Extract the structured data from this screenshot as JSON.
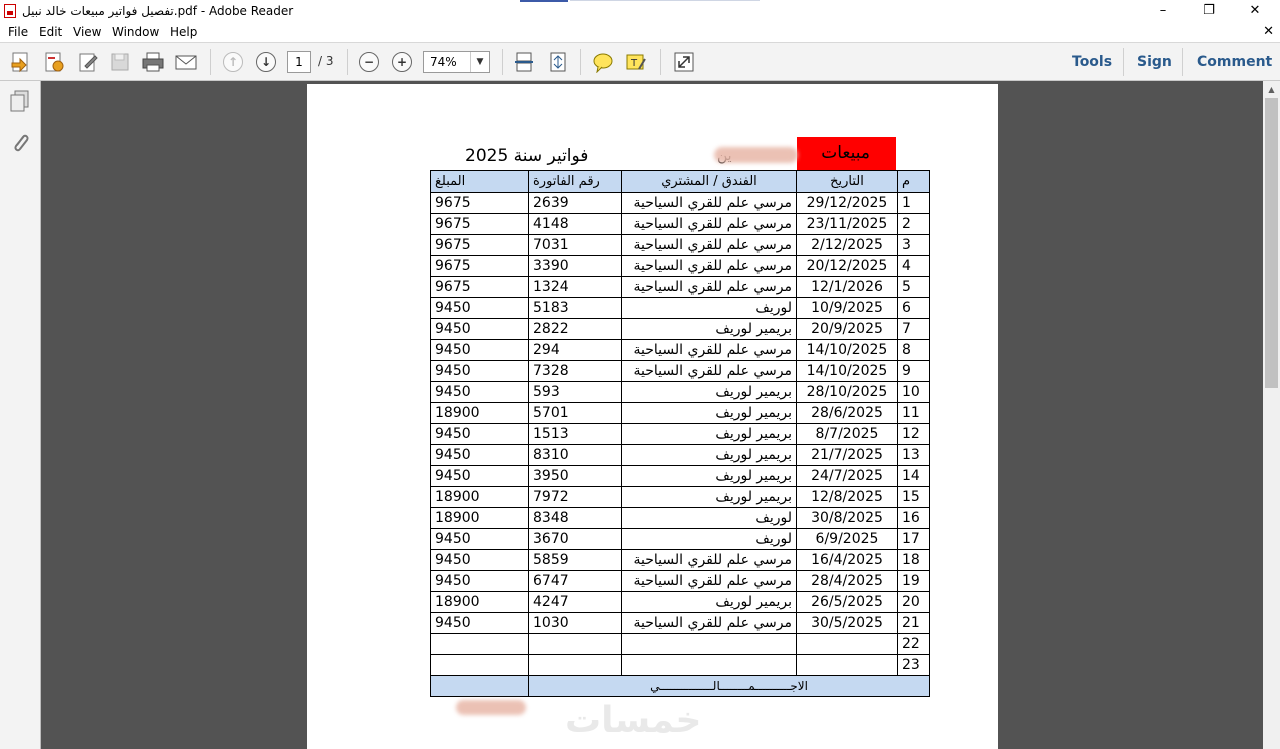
{
  "window": {
    "title": "تفصيل فواتير  مبيعات خالد نبيل.pdf - Adobe Reader",
    "controls": [
      "–",
      "❐",
      "✕"
    ]
  },
  "menu": {
    "items": [
      "File",
      "Edit",
      "View",
      "Window",
      "Help"
    ],
    "close": "✕"
  },
  "toolbar": {
    "page_current": "1",
    "page_total": "/ 3",
    "zoom": "74%",
    "tools_label": "Tools",
    "sign_label": "Sign",
    "comment_label": "Comment"
  },
  "document": {
    "sheet_label": "مبيعات",
    "sheet_title": "فواتير سنة 2025",
    "partial_text": "ين",
    "headers": {
      "num": "م",
      "date": "التاريخ",
      "hotel": "الفندق / المشتري",
      "invoice": "رقم الفاتورة",
      "amount": "المبلغ"
    },
    "rows": [
      {
        "num": "1",
        "date": "29/12/2025",
        "hotel": "مرسي علم للقري السياحية",
        "invoice": "2639",
        "amount": "9675"
      },
      {
        "num": "2",
        "date": "23/11/2025",
        "hotel": "مرسي علم للقري السياحية",
        "invoice": "4148",
        "amount": "9675"
      },
      {
        "num": "3",
        "date": "2/12/2025",
        "hotel": "مرسي علم للقري السياحية",
        "invoice": "7031",
        "amount": "9675"
      },
      {
        "num": "4",
        "date": "20/12/2025",
        "hotel": "مرسي علم للقري السياحية",
        "invoice": "3390",
        "amount": "9675"
      },
      {
        "num": "5",
        "date": "12/1/2026",
        "hotel": "مرسي علم للقري السياحية",
        "invoice": "1324",
        "amount": "9675"
      },
      {
        "num": "6",
        "date": "10/9/2025",
        "hotel": "لوريف",
        "invoice": "5183",
        "amount": "9450"
      },
      {
        "num": "7",
        "date": "20/9/2025",
        "hotel": "بريمير لوريف",
        "invoice": "2822",
        "amount": "9450"
      },
      {
        "num": "8",
        "date": "14/10/2025",
        "hotel": "مرسي علم للقري السياحية",
        "invoice": "294",
        "amount": "9450"
      },
      {
        "num": "9",
        "date": "14/10/2025",
        "hotel": "مرسي علم للقري السياحية",
        "invoice": "7328",
        "amount": "9450"
      },
      {
        "num": "10",
        "date": "28/10/2025",
        "hotel": "بريمير لوريف",
        "invoice": "593",
        "amount": "9450"
      },
      {
        "num": "11",
        "date": "28/6/2025",
        "hotel": "بريمير لوريف",
        "invoice": "5701",
        "amount": "18900"
      },
      {
        "num": "12",
        "date": "8/7/2025",
        "hotel": "بريمير لوريف",
        "invoice": "1513",
        "amount": "9450"
      },
      {
        "num": "13",
        "date": "21/7/2025",
        "hotel": "بريمير لوريف",
        "invoice": "8310",
        "amount": "9450"
      },
      {
        "num": "14",
        "date": "24/7/2025",
        "hotel": "بريمير لوريف",
        "invoice": "3950",
        "amount": "9450"
      },
      {
        "num": "15",
        "date": "12/8/2025",
        "hotel": "بريمير لوريف",
        "invoice": "7972",
        "amount": "18900"
      },
      {
        "num": "16",
        "date": "30/8/2025",
        "hotel": "لوريف",
        "invoice": "8348",
        "amount": "18900"
      },
      {
        "num": "17",
        "date": "6/9/2025",
        "hotel": "لوريف",
        "invoice": "3670",
        "amount": "9450"
      },
      {
        "num": "18",
        "date": "16/4/2025",
        "hotel": "مرسي علم للقري السياحية",
        "invoice": "5859",
        "amount": "9450"
      },
      {
        "num": "19",
        "date": "28/4/2025",
        "hotel": "مرسي علم للقري السياحية",
        "invoice": "6747",
        "amount": "9450"
      },
      {
        "num": "20",
        "date": "26/5/2025",
        "hotel": "بريمير لوريف",
        "invoice": "4247",
        "amount": "18900"
      },
      {
        "num": "21",
        "date": "30/5/2025",
        "hotel": "مرسي علم للقري السياحية",
        "invoice": "1030",
        "amount": "9450"
      },
      {
        "num": "22",
        "date": "",
        "hotel": "",
        "invoice": "",
        "amount": ""
      },
      {
        "num": "23",
        "date": "",
        "hotel": "",
        "invoice": "",
        "amount": ""
      }
    ],
    "total_label": "الاجــــــــــمــــــــالـــــــــــــــي",
    "watermark": "خمسات"
  },
  "colors": {
    "header_fill": "#c5d9f1",
    "sheet_label_fill": "#ff0000",
    "link_blue": "#2a5a8c",
    "doc_background": "#535353"
  }
}
